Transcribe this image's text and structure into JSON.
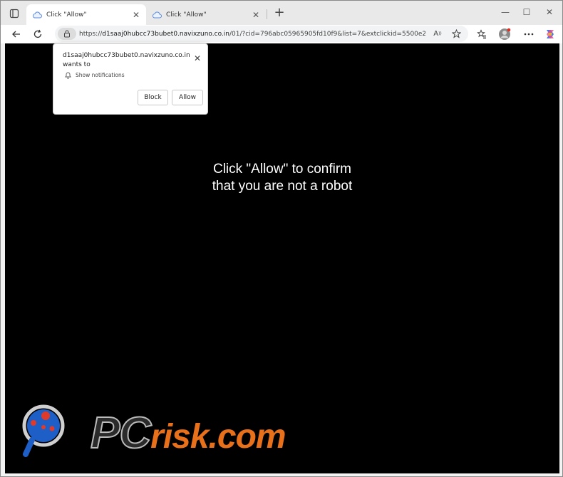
{
  "tabs": [
    {
      "title": "Click \"Allow\"",
      "active": true
    },
    {
      "title": "Click \"Allow\"",
      "active": false
    }
  ],
  "new_tab_symbol": "+",
  "window_controls": {
    "minimize": "—",
    "maximize": "☐",
    "close": "✕"
  },
  "toolbar": {
    "back_icon": "back-arrow-icon",
    "refresh_icon": "refresh-icon",
    "url_prefix": "https://",
    "url_host": "d1saaj0hubcc73bubet0.navixzuno.co.in",
    "url_path": "/01/?cid=796abc05965905fd10f9&list=7&extclickid=5500e263...",
    "read_aloud_icon": "read-aloud-icon",
    "favorite_icon": "star-icon",
    "favorites_bar_icon": "favorites-icon",
    "profile_icon": "profile-icon",
    "menu_icon": "more-icon",
    "copilot_icon": "copilot-icon"
  },
  "popup": {
    "origin": "d1saaj0hubcc73bubet0.navixzuno.co.in",
    "wants_to": "wants to",
    "permission": "Show notifications",
    "block_label": "Block",
    "allow_label": "Allow",
    "close_symbol": "✕"
  },
  "page": {
    "headline_line1": "Click \"Allow\" to confirm",
    "headline_line2": "that you are not a robot"
  },
  "watermark": {
    "pc": "PC",
    "risk": "risk.com"
  },
  "colors": {
    "page_bg": "#000000",
    "headline": "#ffffff",
    "watermark_orange": "#e8701a"
  }
}
